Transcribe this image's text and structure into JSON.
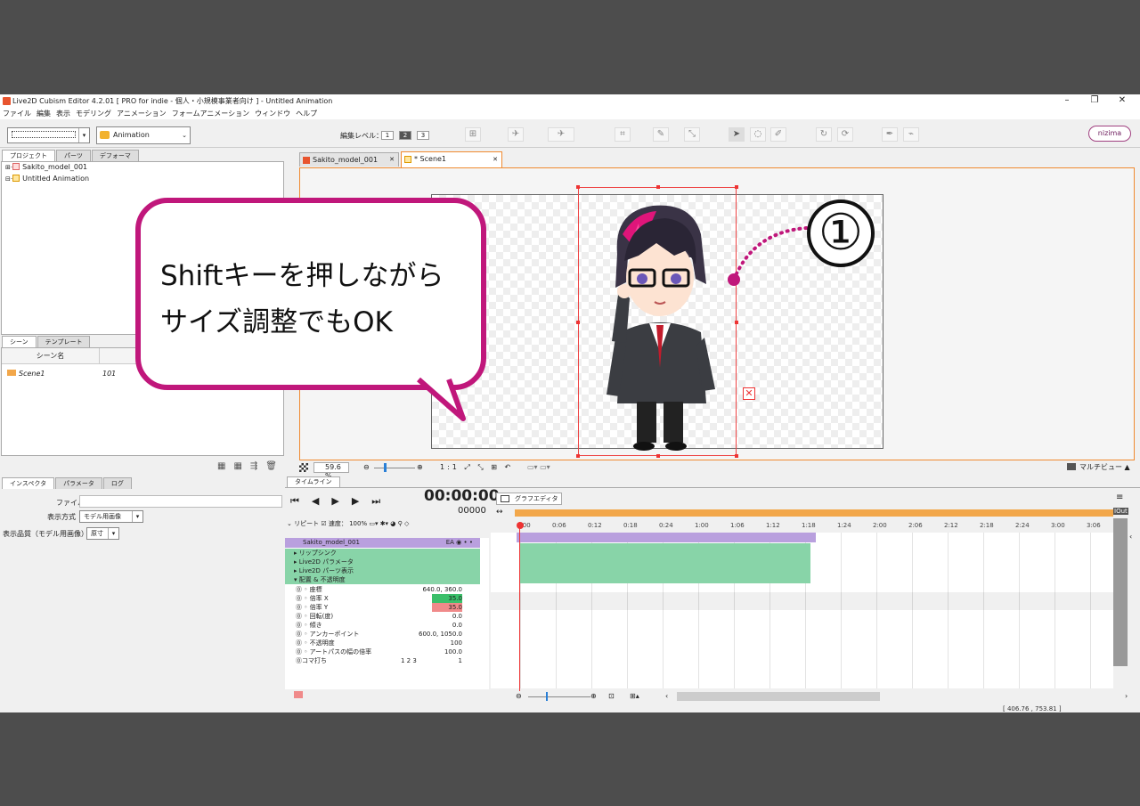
{
  "window": {
    "title": "Live2D Cubism Editor 4.2.01   [ PRO for indie - 個人・小規模事業者向け ] - Untitled Animation",
    "minimize": "–",
    "maximize": "❐",
    "close": "✕"
  },
  "menu": [
    "ファイル",
    "編集",
    "表示",
    "モデリング",
    "アニメーション",
    "フォームアニメーション",
    "ウィンドウ",
    "ヘルプ"
  ],
  "toolbar": {
    "workspace_value": "Animation",
    "edit_level_label": "編集レベル：",
    "edit_levels": [
      "1",
      "2",
      "3"
    ],
    "nizima": "nizima"
  },
  "project_panel": {
    "tabs": [
      "プロジェクト",
      "パーツ",
      "デフォーマ"
    ],
    "items": [
      "Sakito_model_001",
      "Untitled Animation"
    ]
  },
  "scene_panel": {
    "tabs": [
      "シーン",
      "テンプレート"
    ],
    "header_name": "シーン名",
    "rows": [
      {
        "name": "Scene1",
        "length": "101"
      }
    ]
  },
  "inspector": {
    "tabs": [
      "インスペクタ",
      "パラメータ",
      "ログ"
    ],
    "file_label": "ファイル",
    "display_mode_label": "表示方式",
    "display_mode_value": "モデル用画像",
    "quality_label": "表示品質（モデル用画像）",
    "quality_value": "原寸"
  },
  "viewer": {
    "tabs": [
      "Sakito_model_001",
      "* Scene1"
    ],
    "zoom": "59.6 %",
    "multiview": "マルチビュー"
  },
  "callout": {
    "line1": "Shiftキーを押しながら",
    "line2": "サイズ調整でもOK",
    "number": "①"
  },
  "timeline": {
    "tab": "タイムライン",
    "time": "00:00:00",
    "frame": "00000",
    "repeat_label": "リピート",
    "speed_label": "速度： 100%",
    "graph_editor": "グラフエディタ",
    "model_row": "Sakito_model_001",
    "groups": [
      "リップシンク",
      "Live2D パラメータ",
      "Live2D パーツ表示",
      "配置 & 不透明度"
    ],
    "props": [
      {
        "name": "座標",
        "value": "640.0,  360.0"
      },
      {
        "name": "倍率 X",
        "value": "35.0"
      },
      {
        "name": "倍率 Y",
        "value": "35.0"
      },
      {
        "name": "回転(度)",
        "value": "0.0"
      },
      {
        "name": "傾き",
        "value": "0.0"
      },
      {
        "name": "アンカーポイント",
        "value": "600.0,  1050.0"
      },
      {
        "name": "不透明度",
        "value": "100"
      },
      {
        "name": "アートパスの幅の倍率",
        "value": "100.0"
      },
      {
        "name": "コマ打ち",
        "value": "1"
      }
    ],
    "ruler": [
      "0:00",
      "0:06",
      "0:12",
      "0:18",
      "0:24",
      "1:00",
      "1:06",
      "1:12",
      "1:18",
      "1:24",
      "2:00",
      "2:06",
      "2:12",
      "2:18",
      "2:24",
      "3:00",
      "3:06"
    ],
    "end_label": "IOut"
  },
  "status": "[  406.76 ,  753.81 ]",
  "colors": {
    "accent": "#c0177b",
    "selection": "#e33333",
    "keyframe_bar": "#88d4a8",
    "model_bar": "#b9a0de",
    "ruler_bar": "#f2a74a"
  }
}
